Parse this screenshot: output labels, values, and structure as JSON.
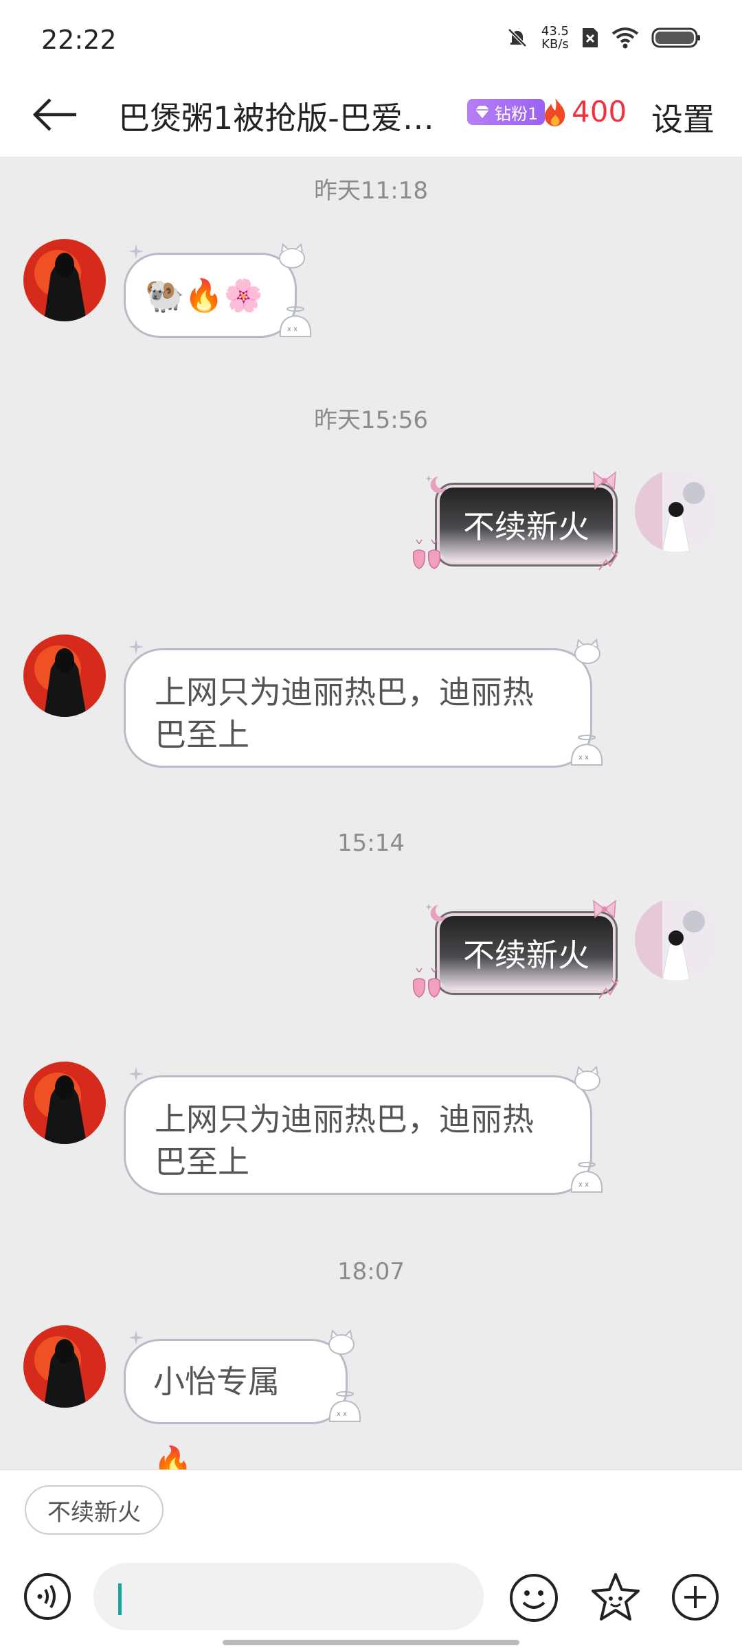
{
  "status_bar": {
    "time": "22:22",
    "net_speed_value": "43.5",
    "net_speed_unit": "KB/s",
    "icons": [
      "bell-mute-icon",
      "sim-off-icon",
      "wifi-icon",
      "battery-icon"
    ]
  },
  "header": {
    "title": "巴煲粥1被抢版-巴爱…",
    "fan_badge": "钻粉1",
    "fire_count": "400",
    "settings_label": "设置"
  },
  "messages": [
    {
      "type": "timestamp",
      "text": "昨天11:18"
    },
    {
      "type": "incoming",
      "text": "🐏🔥🌸"
    },
    {
      "type": "timestamp",
      "text": "昨天15:56"
    },
    {
      "type": "outgoing",
      "text": "不续新火"
    },
    {
      "type": "incoming",
      "text": "上网只为迪丽热巴，迪丽热巴至上"
    },
    {
      "type": "timestamp",
      "text": "15:14"
    },
    {
      "type": "outgoing",
      "text": "不续新火"
    },
    {
      "type": "incoming",
      "text": "上网只为迪丽热巴，迪丽热巴至上"
    },
    {
      "type": "timestamp",
      "text": "18:07"
    },
    {
      "type": "incoming",
      "text": "小怡专属🔥"
    }
  ],
  "quick_reply": {
    "label": "不续新火"
  },
  "input": {
    "placeholder": ""
  },
  "colors": {
    "accent_fire": "#f0323c",
    "badge_purple": "#a66ff2",
    "cursor_teal": "#1aa39a",
    "chat_background": "#ececec"
  }
}
